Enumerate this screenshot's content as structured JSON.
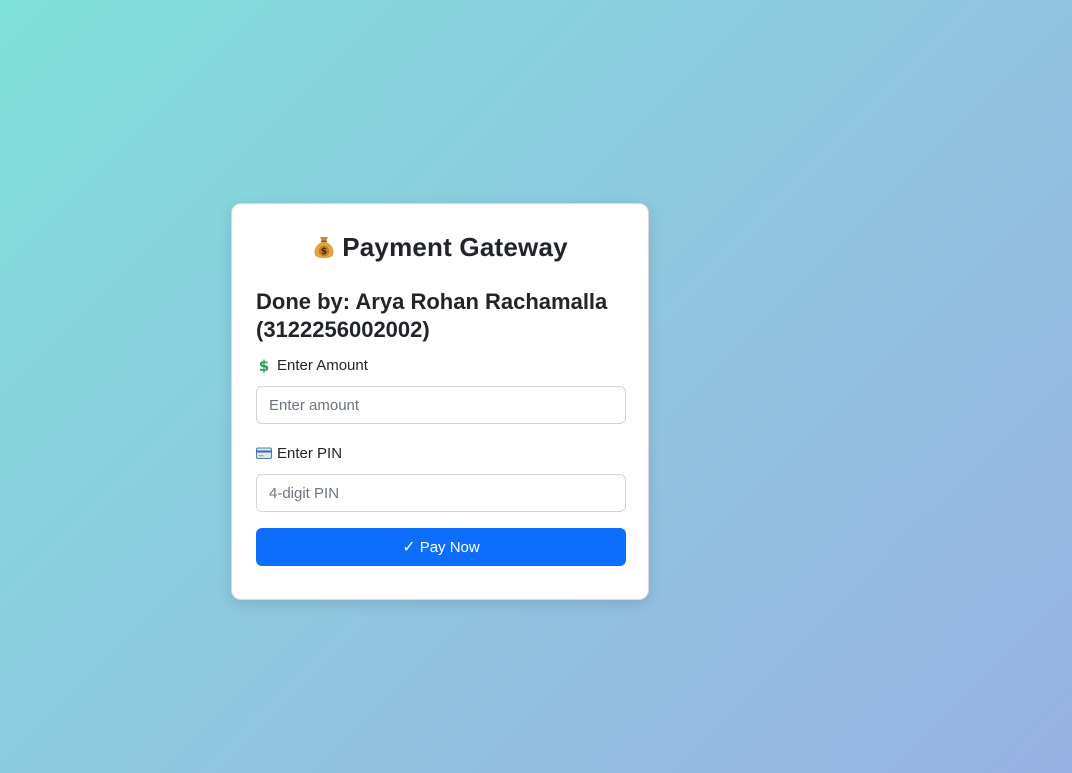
{
  "header": {
    "title": "Payment Gateway",
    "title_icon": "money-bag-icon"
  },
  "author": {
    "text": "Done by: Arya Rohan Rachamalla (3122256002002)"
  },
  "amount": {
    "label": "Enter Amount",
    "label_icon": "dollar-sign-icon",
    "placeholder": "Enter amount"
  },
  "pin": {
    "label": "Enter PIN",
    "label_icon": "credit-card-icon",
    "placeholder": "4-digit PIN"
  },
  "pay_button": {
    "icon": "checkmark-icon",
    "label": "Pay Now"
  },
  "colors": {
    "primary": "#0d6efd",
    "card_background": "#ffffff",
    "background_start": "#7fe0da",
    "background_end": "#98b1e4"
  }
}
